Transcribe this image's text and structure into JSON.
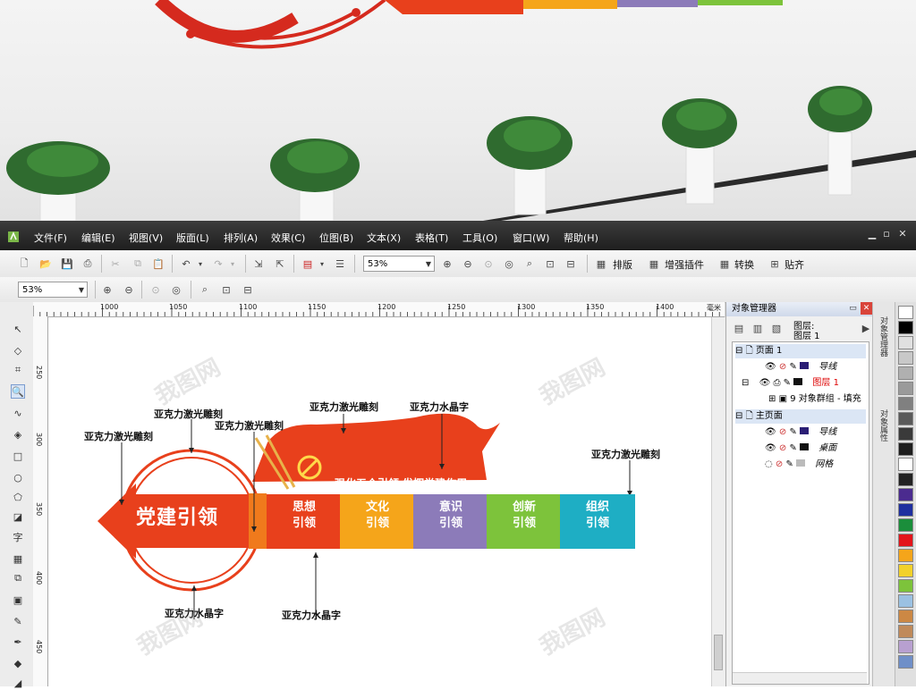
{
  "menu": {
    "items": [
      "文件(F)",
      "编辑(E)",
      "视图(V)",
      "版面(L)",
      "排列(A)",
      "效果(C)",
      "位图(B)",
      "文本(X)",
      "表格(T)",
      "工具(O)",
      "窗口(W)",
      "帮助(H)"
    ]
  },
  "toolbar": {
    "zoom_value": "53%",
    "zoom_value_2": "53%",
    "plugin_buttons": [
      "排版",
      "增强插件",
      "转换",
      "贴齐"
    ]
  },
  "ruler": {
    "h_ticks": [
      "1000",
      "1050",
      "1100",
      "1150",
      "1200",
      "1250",
      "1300",
      "1350",
      "1400"
    ],
    "h_unit": "毫米",
    "v_ticks": [
      "250",
      "300",
      "350",
      "400",
      "450"
    ]
  },
  "docker": {
    "title": "对象管理器",
    "layer_header_label": "图层:",
    "layer_header_value": "图层 1",
    "tree": {
      "page1": "页面 1",
      "page1_guides": "导线",
      "page1_layer1": "图层 1",
      "page1_group": "9 对象群组 - 填充",
      "master": "主页面",
      "master_guides": "导线",
      "master_desktop": "桌面",
      "master_grid": "网格"
    },
    "side_tabs": [
      "对象管理器",
      "对象属性"
    ]
  },
  "artwork": {
    "main_title": "党建引领",
    "banner_text": "强化五个引领  发挥党建作用",
    "blocks": [
      {
        "line1": "思想",
        "line2": "引领",
        "color": "#e8401c"
      },
      {
        "line1": "文化",
        "line2": "引领",
        "color": "#f5a51a"
      },
      {
        "line1": "意识",
        "line2": "引领",
        "color": "#8c7bb9"
      },
      {
        "line1": "创新",
        "line2": "引领",
        "color": "#7dc33b"
      },
      {
        "line1": "组织",
        "line2": "引领",
        "color": "#1eaec4"
      }
    ],
    "annotations": [
      "亚克力激光雕刻",
      "亚克力激光雕刻",
      "亚克力激光雕刻",
      "亚克力激光雕刻",
      "亚克力激光雕刻",
      "亚克力水晶字",
      "亚克力水晶字",
      "亚克力水晶字"
    ],
    "watermark": "我图网"
  },
  "colors": {
    "party_red": "#e8401c",
    "orange": "#f5a51a",
    "purple": "#8c7bb9",
    "green": "#7dc33b",
    "cyan": "#1eaec4"
  },
  "palette": [
    "#ffffff",
    "#000000",
    "#e0e0e0",
    "#c8c8c8",
    "#b0b0b0",
    "#9a9a9a",
    "#808080",
    "#5a5a5a",
    "#3a3a3a",
    "#1e1e1e",
    "#ffffff",
    "#222222",
    "#4b2b8f",
    "#1f2f9f",
    "#1b8e3b",
    "#e3141b",
    "#f5a51a",
    "#f2d12a",
    "#7dc33b",
    "#9bc1e2",
    "#cc8844",
    "#c08a5a",
    "#b8a0d0",
    "#6f8fc8"
  ]
}
